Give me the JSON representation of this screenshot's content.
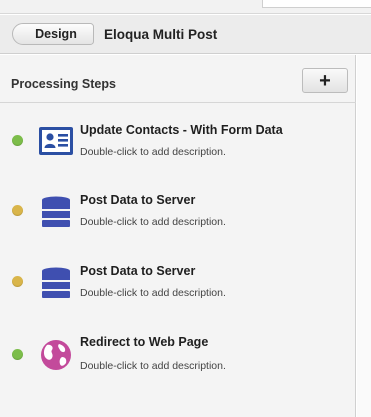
{
  "header": {
    "back_label": "Design",
    "title": "Eloqua Multi Post"
  },
  "panel": {
    "title": "Processing Steps",
    "add_label": "+"
  },
  "colors": {
    "status_green": "#7cbd4a",
    "status_yellow": "#d9b54a",
    "contact_icon": "#2b4fa3",
    "server_icon": "#3f4fb0",
    "web_icon": "#c34a9b"
  },
  "steps": [
    {
      "title": "Update Contacts - With Form Data",
      "description": "Double-click to add description.",
      "status": "green",
      "icon": "contact-card-icon"
    },
    {
      "title": "Post Data to Server",
      "description": "Double-click to add description.",
      "status": "yellow",
      "icon": "server-icon"
    },
    {
      "title": "Post Data to Server",
      "description": "Double-click to add description.",
      "status": "yellow",
      "icon": "server-icon"
    },
    {
      "title": "Redirect to Web Page",
      "description": "Double-click to add description.",
      "status": "green",
      "icon": "globe-icon"
    }
  ]
}
